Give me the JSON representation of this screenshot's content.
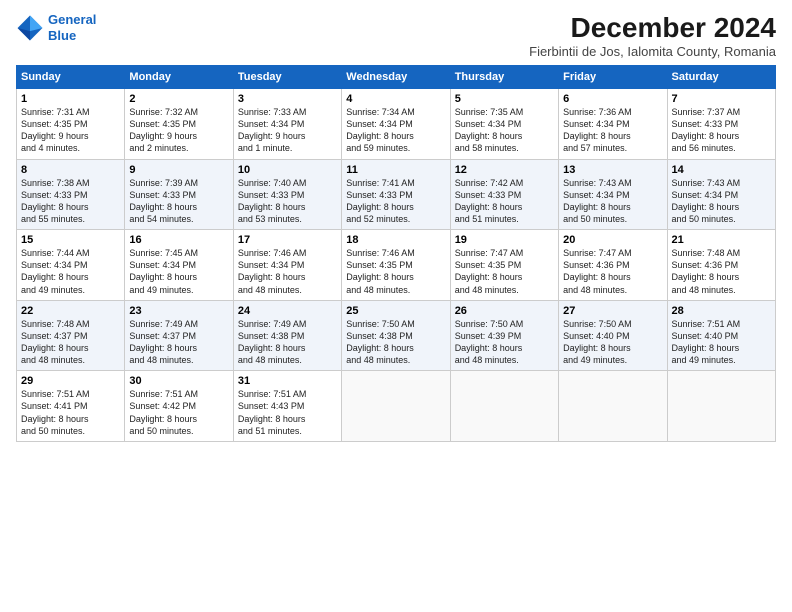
{
  "logo": {
    "line1": "General",
    "line2": "Blue"
  },
  "title": "December 2024",
  "subtitle": "Fierbintii de Jos, Ialomita County, Romania",
  "days_header": [
    "Sunday",
    "Monday",
    "Tuesday",
    "Wednesday",
    "Thursday",
    "Friday",
    "Saturday"
  ],
  "weeks": [
    [
      {
        "day": "1",
        "info": "Sunrise: 7:31 AM\nSunset: 4:35 PM\nDaylight: 9 hours\nand 4 minutes."
      },
      {
        "day": "2",
        "info": "Sunrise: 7:32 AM\nSunset: 4:35 PM\nDaylight: 9 hours\nand 2 minutes."
      },
      {
        "day": "3",
        "info": "Sunrise: 7:33 AM\nSunset: 4:34 PM\nDaylight: 9 hours\nand 1 minute."
      },
      {
        "day": "4",
        "info": "Sunrise: 7:34 AM\nSunset: 4:34 PM\nDaylight: 8 hours\nand 59 minutes."
      },
      {
        "day": "5",
        "info": "Sunrise: 7:35 AM\nSunset: 4:34 PM\nDaylight: 8 hours\nand 58 minutes."
      },
      {
        "day": "6",
        "info": "Sunrise: 7:36 AM\nSunset: 4:34 PM\nDaylight: 8 hours\nand 57 minutes."
      },
      {
        "day": "7",
        "info": "Sunrise: 7:37 AM\nSunset: 4:33 PM\nDaylight: 8 hours\nand 56 minutes."
      }
    ],
    [
      {
        "day": "8",
        "info": "Sunrise: 7:38 AM\nSunset: 4:33 PM\nDaylight: 8 hours\nand 55 minutes."
      },
      {
        "day": "9",
        "info": "Sunrise: 7:39 AM\nSunset: 4:33 PM\nDaylight: 8 hours\nand 54 minutes."
      },
      {
        "day": "10",
        "info": "Sunrise: 7:40 AM\nSunset: 4:33 PM\nDaylight: 8 hours\nand 53 minutes."
      },
      {
        "day": "11",
        "info": "Sunrise: 7:41 AM\nSunset: 4:33 PM\nDaylight: 8 hours\nand 52 minutes."
      },
      {
        "day": "12",
        "info": "Sunrise: 7:42 AM\nSunset: 4:33 PM\nDaylight: 8 hours\nand 51 minutes."
      },
      {
        "day": "13",
        "info": "Sunrise: 7:43 AM\nSunset: 4:34 PM\nDaylight: 8 hours\nand 50 minutes."
      },
      {
        "day": "14",
        "info": "Sunrise: 7:43 AM\nSunset: 4:34 PM\nDaylight: 8 hours\nand 50 minutes."
      }
    ],
    [
      {
        "day": "15",
        "info": "Sunrise: 7:44 AM\nSunset: 4:34 PM\nDaylight: 8 hours\nand 49 minutes."
      },
      {
        "day": "16",
        "info": "Sunrise: 7:45 AM\nSunset: 4:34 PM\nDaylight: 8 hours\nand 49 minutes."
      },
      {
        "day": "17",
        "info": "Sunrise: 7:46 AM\nSunset: 4:34 PM\nDaylight: 8 hours\nand 48 minutes."
      },
      {
        "day": "18",
        "info": "Sunrise: 7:46 AM\nSunset: 4:35 PM\nDaylight: 8 hours\nand 48 minutes."
      },
      {
        "day": "19",
        "info": "Sunrise: 7:47 AM\nSunset: 4:35 PM\nDaylight: 8 hours\nand 48 minutes."
      },
      {
        "day": "20",
        "info": "Sunrise: 7:47 AM\nSunset: 4:36 PM\nDaylight: 8 hours\nand 48 minutes."
      },
      {
        "day": "21",
        "info": "Sunrise: 7:48 AM\nSunset: 4:36 PM\nDaylight: 8 hours\nand 48 minutes."
      }
    ],
    [
      {
        "day": "22",
        "info": "Sunrise: 7:48 AM\nSunset: 4:37 PM\nDaylight: 8 hours\nand 48 minutes."
      },
      {
        "day": "23",
        "info": "Sunrise: 7:49 AM\nSunset: 4:37 PM\nDaylight: 8 hours\nand 48 minutes."
      },
      {
        "day": "24",
        "info": "Sunrise: 7:49 AM\nSunset: 4:38 PM\nDaylight: 8 hours\nand 48 minutes."
      },
      {
        "day": "25",
        "info": "Sunrise: 7:50 AM\nSunset: 4:38 PM\nDaylight: 8 hours\nand 48 minutes."
      },
      {
        "day": "26",
        "info": "Sunrise: 7:50 AM\nSunset: 4:39 PM\nDaylight: 8 hours\nand 48 minutes."
      },
      {
        "day": "27",
        "info": "Sunrise: 7:50 AM\nSunset: 4:40 PM\nDaylight: 8 hours\nand 49 minutes."
      },
      {
        "day": "28",
        "info": "Sunrise: 7:51 AM\nSunset: 4:40 PM\nDaylight: 8 hours\nand 49 minutes."
      }
    ],
    [
      {
        "day": "29",
        "info": "Sunrise: 7:51 AM\nSunset: 4:41 PM\nDaylight: 8 hours\nand 50 minutes."
      },
      {
        "day": "30",
        "info": "Sunrise: 7:51 AM\nSunset: 4:42 PM\nDaylight: 8 hours\nand 50 minutes."
      },
      {
        "day": "31",
        "info": "Sunrise: 7:51 AM\nSunset: 4:43 PM\nDaylight: 8 hours\nand 51 minutes."
      },
      {
        "day": "",
        "info": ""
      },
      {
        "day": "",
        "info": ""
      },
      {
        "day": "",
        "info": ""
      },
      {
        "day": "",
        "info": ""
      }
    ]
  ]
}
